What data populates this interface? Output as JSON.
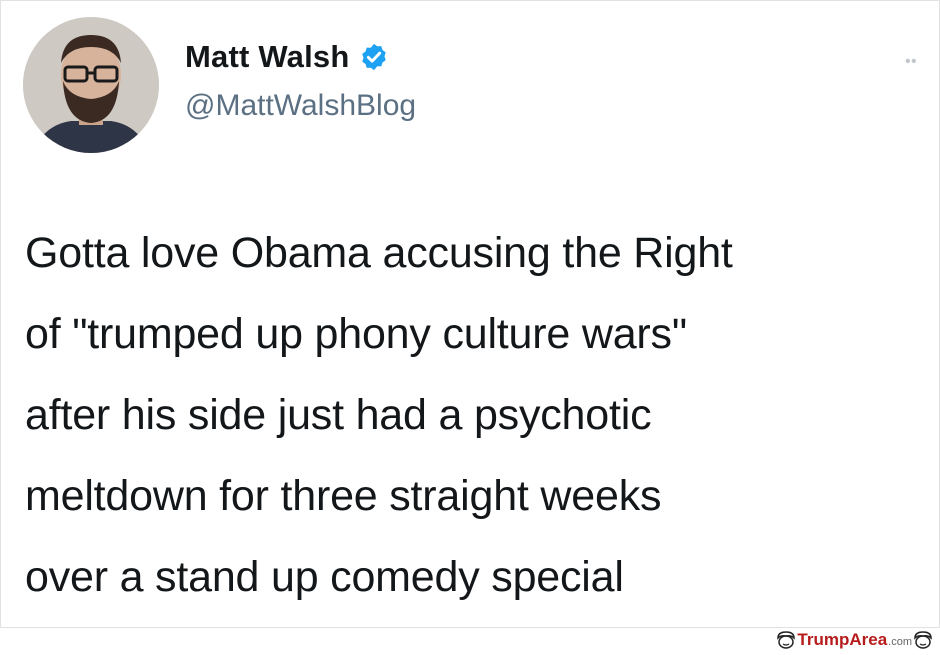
{
  "tweet": {
    "display_name": "Matt Walsh",
    "handle": "@MattWalshBlog",
    "text": "Gotta love Obama accusing the Right\nof \"trumped up phony culture wars\"\nafter his side just had a psychotic\nmeltdown for three straight weeks\nover a stand up comedy special",
    "verified": true,
    "more_icon": "more-dots-icon"
  },
  "watermark": {
    "brand": "TrumpArea",
    "tld": ".com",
    "icon": "trump-face-icon"
  },
  "colors": {
    "text": "#14171a",
    "handle": "#5b7083",
    "verified": "#1da1f2",
    "watermark": "#b71c1c"
  }
}
